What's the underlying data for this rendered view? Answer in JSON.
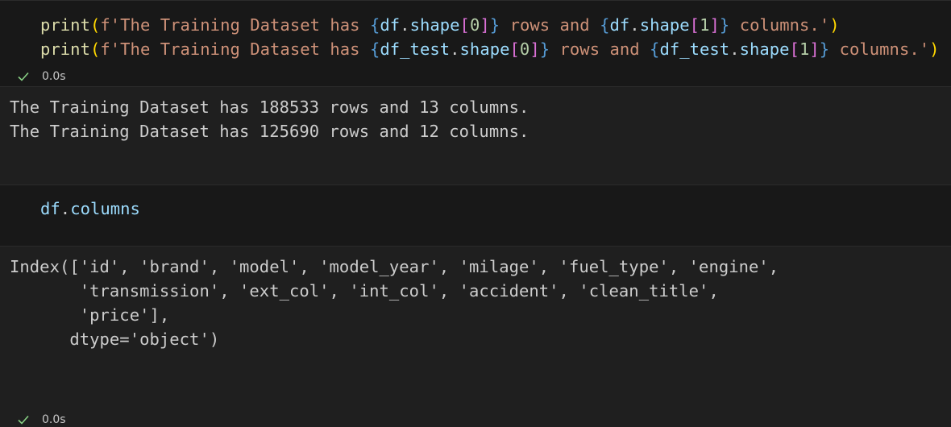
{
  "cells": [
    {
      "code_lines": [
        [
          {
            "t": "print",
            "c": "func"
          },
          {
            "t": "(",
            "c": "yellow"
          },
          {
            "t": "f'The Training Dataset has ",
            "c": "str"
          },
          {
            "t": "{",
            "c": "brace"
          },
          {
            "t": "df",
            "c": "var"
          },
          {
            "t": ".",
            "c": "default"
          },
          {
            "t": "shape",
            "c": "var"
          },
          {
            "t": "[",
            "c": "pink"
          },
          {
            "t": "0",
            "c": "num"
          },
          {
            "t": "]",
            "c": "pink"
          },
          {
            "t": "}",
            "c": "brace"
          },
          {
            "t": " rows and ",
            "c": "str"
          },
          {
            "t": "{",
            "c": "brace"
          },
          {
            "t": "df",
            "c": "var"
          },
          {
            "t": ".",
            "c": "default"
          },
          {
            "t": "shape",
            "c": "var"
          },
          {
            "t": "[",
            "c": "pink"
          },
          {
            "t": "1",
            "c": "num"
          },
          {
            "t": "]",
            "c": "pink"
          },
          {
            "t": "}",
            "c": "brace"
          },
          {
            "t": " columns.'",
            "c": "str"
          },
          {
            "t": ")",
            "c": "yellow"
          }
        ],
        [
          {
            "t": "print",
            "c": "func"
          },
          {
            "t": "(",
            "c": "yellow"
          },
          {
            "t": "f'The Training Dataset has ",
            "c": "str"
          },
          {
            "t": "{",
            "c": "brace"
          },
          {
            "t": "df_test",
            "c": "var"
          },
          {
            "t": ".",
            "c": "default"
          },
          {
            "t": "shape",
            "c": "var"
          },
          {
            "t": "[",
            "c": "pink"
          },
          {
            "t": "0",
            "c": "num"
          },
          {
            "t": "]",
            "c": "pink"
          },
          {
            "t": "}",
            "c": "brace"
          },
          {
            "t": " rows and ",
            "c": "str"
          },
          {
            "t": "{",
            "c": "brace"
          },
          {
            "t": "df_test",
            "c": "var"
          },
          {
            "t": ".",
            "c": "default"
          },
          {
            "t": "shape",
            "c": "var"
          },
          {
            "t": "[",
            "c": "pink"
          },
          {
            "t": "1",
            "c": "num"
          },
          {
            "t": "]",
            "c": "pink"
          },
          {
            "t": "}",
            "c": "brace"
          },
          {
            "t": " columns.'",
            "c": "str"
          },
          {
            "t": ")",
            "c": "yellow"
          }
        ]
      ],
      "status_time": "0.0s",
      "output": "The Training Dataset has 188533 rows and 13 columns.\nThe Training Dataset has 125690 rows and 12 columns."
    },
    {
      "code_lines": [
        [
          {
            "t": "df",
            "c": "var"
          },
          {
            "t": ".",
            "c": "default"
          },
          {
            "t": "columns",
            "c": "var"
          }
        ]
      ],
      "status_time": "0.0s",
      "output": "Index(['id', 'brand', 'model', 'model_year', 'milage', 'fuel_type', 'engine',\n       'transmission', 'ext_col', 'int_col', 'accident', 'clean_title',\n       'price'],\n      dtype='object')"
    }
  ],
  "icons": {
    "status_check": "check-icon"
  },
  "colors": {
    "background": "#1f1f1f",
    "cell_background": "#181818",
    "function": "#dcdcaa",
    "string": "#ce9178",
    "brace": "#569cd6",
    "variable": "#9cdcfe",
    "number": "#b5cea8",
    "paren": "#ffd700",
    "bracket": "#da70d6",
    "check": "#89d185"
  }
}
